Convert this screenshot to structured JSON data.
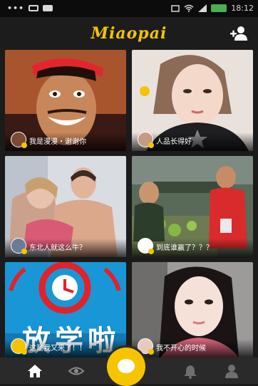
{
  "status_bar": {
    "time": "18:12"
  },
  "app": {
    "logo_text": "Miaopai"
  },
  "colors": {
    "accent": "#f5c400",
    "tab_bar": "#2a2a2a"
  },
  "feed": {
    "items": [
      {
        "caption": "我是漫漫・谢谢你"
      },
      {
        "caption": "人品长得好"
      },
      {
        "caption": "东北人就这么牛？"
      },
      {
        "caption": "到底谁赢了？？？"
      },
      {
        "caption": "这是我又来了！！",
        "overlay": "放学啦"
      },
      {
        "caption": "我不开心的时候"
      }
    ]
  },
  "tabs": [
    {
      "icon": "home-icon",
      "active": true
    },
    {
      "icon": "eye-icon"
    },
    {
      "icon": "record-icon"
    },
    {
      "icon": "bell-icon"
    },
    {
      "icon": "person-icon"
    }
  ]
}
